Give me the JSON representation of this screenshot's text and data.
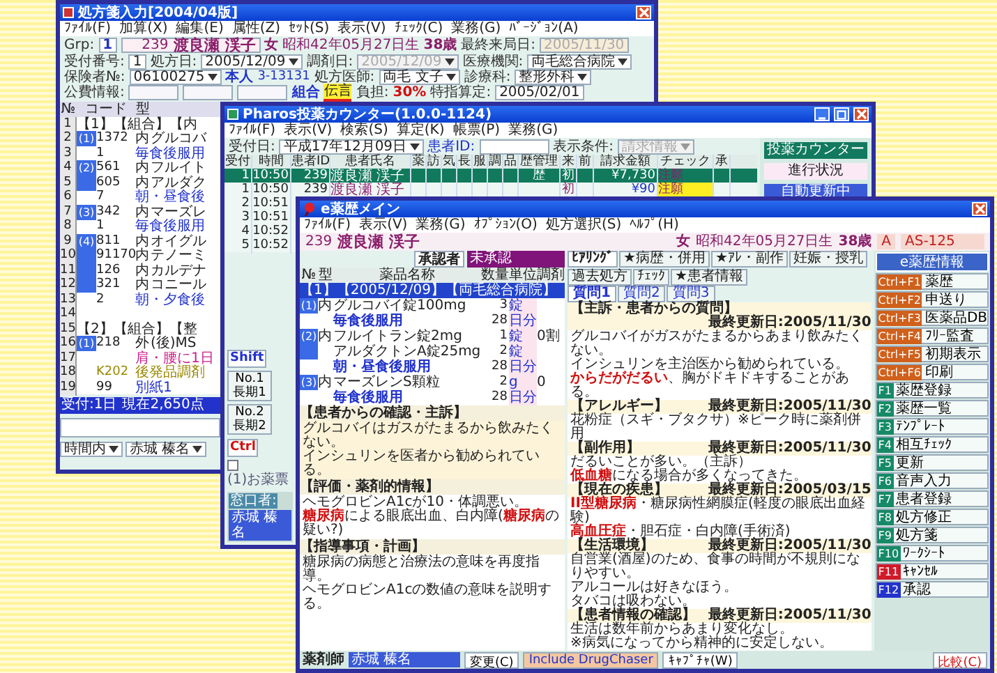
{
  "prescription_window": {
    "title": "処方箋入力[2004/04版]",
    "menu": [
      "ﾌｧｲﾙ(F)",
      "加算(X)",
      "編集(E)",
      "属性(Z)",
      "ｾｯﾄ(S)",
      "表示(V)",
      "ﾁｪｯｸ(C)",
      "業務(G)",
      "ﾊﾞｰｼﾞｮﾝ(A)"
    ],
    "patient": {
      "group_label": "Grp:",
      "group": "1",
      "id": "239",
      "name": "渡良瀬 渓子",
      "sex": "女",
      "birth": "昭和42年05月27日生",
      "age": "38歳",
      "last_visit_label": "最終来局日:",
      "last_visit": "2005/11/30"
    },
    "form_rows": [
      [
        {
          "kind": "label",
          "text": "受付番号:"
        },
        {
          "kind": "field",
          "text": "1",
          "disabled": false
        },
        {
          "kind": "label",
          "text": "処方日:"
        },
        {
          "kind": "combo",
          "text": "2005/12/09",
          "disabled": false
        },
        {
          "kind": "label",
          "text": "調剤日:"
        },
        {
          "kind": "combo",
          "text": "2005/12/09",
          "disabled": true
        },
        {
          "kind": "label",
          "text": "医療機関:"
        },
        {
          "kind": "combo",
          "text": "両毛総合病院",
          "disabled": false
        }
      ],
      [
        {
          "kind": "label",
          "text": "保険者№:"
        },
        {
          "kind": "combo",
          "text": "06100275",
          "disabled": false
        },
        {
          "kind": "accent",
          "text": "本人"
        },
        {
          "kind": "small",
          "text": "3-13131"
        },
        {
          "kind": "label",
          "text": "処方医師:"
        },
        {
          "kind": "combo",
          "text": "両毛 文子",
          "disabled": false
        },
        {
          "kind": "label",
          "text": "診療科:"
        },
        {
          "kind": "combo",
          "text": "整形外科",
          "disabled": false
        }
      ],
      [
        {
          "kind": "label",
          "text": "公費情報:"
        },
        {
          "kind": "blank"
        },
        {
          "kind": "blank"
        },
        {
          "kind": "blank"
        },
        {
          "kind": "accent",
          "text": "組合"
        },
        {
          "kind": "highlight",
          "text": "伝言"
        },
        {
          "kind": "label",
          "text": "負担:"
        },
        {
          "kind": "alert",
          "text": "30%"
        },
        {
          "kind": "label",
          "text": "特指算定:"
        },
        {
          "kind": "field",
          "text": "2005/02/01",
          "disabled": false
        }
      ]
    ],
    "columns": [
      "№",
      "コード",
      "型"
    ],
    "rows": [
      {
        "no": "1",
        "kind": "group",
        "name": "【1】【組合】【内"
      },
      {
        "no": "2",
        "kind": "drug",
        "mark": "(1)",
        "code": "1372",
        "type": "内",
        "name": "グルコバ"
      },
      {
        "no": "3",
        "kind": "usage",
        "code": "1",
        "name": "毎食後服用"
      },
      {
        "no": "4",
        "kind": "drug",
        "mark": "(2)",
        "code": "561",
        "type": "内",
        "name": "フルイト"
      },
      {
        "no": "5",
        "kind": "drug",
        "code": "605",
        "type": "内",
        "name": "アルダク"
      },
      {
        "no": "6",
        "kind": "usage",
        "code": "7",
        "name": "朝・昼食後"
      },
      {
        "no": "7",
        "kind": "drug",
        "mark": "(3)",
        "code": "342",
        "type": "内",
        "name": "マーズレ"
      },
      {
        "no": "8",
        "kind": "usage",
        "code": "1",
        "name": "毎食後服用"
      },
      {
        "no": "9",
        "kind": "drug",
        "mark": "(4)",
        "code": "811",
        "type": "内",
        "name": "オイグル"
      },
      {
        "no": "10",
        "kind": "drug",
        "code": "91170",
        "type": "内",
        "name": "テノーミ"
      },
      {
        "no": "11",
        "kind": "drug",
        "code": "126",
        "type": "内",
        "name": "カルデナ"
      },
      {
        "no": "12",
        "kind": "drug",
        "code": "321",
        "type": "内",
        "name": "コニール"
      },
      {
        "no": "13",
        "kind": "usage",
        "code": "2",
        "name": "朝・夕食後"
      },
      {
        "no": "14",
        "kind": "blank"
      },
      {
        "no": "15",
        "kind": "group",
        "name": "【2】【組合】【整"
      },
      {
        "no": "16",
        "kind": "drug",
        "mark": "(1)",
        "code": "218",
        "type": "外",
        "name": "(後)MS"
      },
      {
        "no": "17",
        "kind": "note",
        "name": "肩・腰に1日"
      },
      {
        "no": "18",
        "kind": "addon",
        "code": "K202",
        "name": "後発品調剤"
      },
      {
        "no": "19",
        "kind": "usage",
        "code": "99",
        "name": "別紙1"
      }
    ],
    "status": [
      "受付:1日",
      "現在2,650点"
    ],
    "time_slot": "時間内",
    "staff": "赤城 榛名"
  },
  "counter_window": {
    "title": "Pharos投薬カウンター(1.0.0-1124)",
    "menu": [
      "ﾌｧｲﾙ(F)",
      "表示(V)",
      "検索(S)",
      "算定(K)",
      "帳票(P)",
      "業務(G)"
    ],
    "date_label": "受付日:",
    "date": "平成17年12月09日",
    "patient_id_label": "患者ID:",
    "filter_label": "表示条件:",
    "filter": "請求情報",
    "columns": [
      "受付",
      "時間",
      "患者ID",
      "患者氏名",
      "薬",
      "訪",
      "気",
      "長",
      "服",
      "調",
      "品",
      "歴管理",
      "来",
      "前",
      "請求金額",
      "チェック",
      "承"
    ],
    "rows": [
      {
        "no": "1",
        "time": "10:50",
        "id": "239",
        "name": "渡良瀬 渓子",
        "history": "歴",
        "visit": "初",
        "amount": "¥7,730",
        "check": "注願",
        "check_alert": false,
        "selected": true
      },
      {
        "no": "1",
        "time": "10:50",
        "id": "239",
        "name": "渡良瀬 渓子",
        "visit": "初",
        "amount": "¥90",
        "check": "注願",
        "check_alert": true,
        "selected": false
      },
      {
        "no": "2",
        "time": "10:51",
        "selected": false
      },
      {
        "no": "3",
        "time": "10:51",
        "selected": false
      },
      {
        "no": "4",
        "time": "10:52",
        "selected": false
      },
      {
        "no": "5",
        "time": "10:52",
        "selected": false
      }
    ],
    "panel": [
      {
        "kind": "title",
        "text": "投薬カウンター"
      },
      {
        "kind": "status",
        "text": "進行状況"
      },
      {
        "kind": "auto",
        "text": "自動更新中"
      }
    ],
    "shift_label": "Shift",
    "shift_buttons": [
      {
        "number": "No.1",
        "label": "長期1"
      },
      {
        "number": "No.2",
        "label": "長期2"
      }
    ],
    "ctrl_label": "Ctrl",
    "options": [
      {
        "label": "(1)お薬票",
        "checked": false
      }
    ],
    "clerk_label": "窓口者:",
    "clerk": "赤城 榛名"
  },
  "record_window": {
    "title": "e薬歴メイン",
    "menu": [
      "ﾌｧｲﾙ(F)",
      "表示(V)",
      "業務(G)",
      "ｵﾌﾟｼｮﾝ(O)",
      "処方選択(S)",
      "ﾍﾙﾌﾟ(H)"
    ],
    "patient": {
      "id": "239",
      "name": "渡良瀬 渓子",
      "sex": "女",
      "birth": "昭和42年05月27日生",
      "age": "38歳",
      "grade": "A",
      "code": "AS-125"
    },
    "approver_label": "承認者",
    "approver": "未承認",
    "columns": [
      "№",
      "型",
      "薬品名称",
      "数量",
      "単位",
      "調剤"
    ],
    "rows": [
      {
        "kind": "header",
        "name": "【1】【2005/12/09】【両毛総合病院】",
        "selected": true
      },
      {
        "kind": "drug",
        "mark": "(1)",
        "type": "内",
        "name": "グルコバイ錠100mg",
        "qty": "3",
        "unit": "錠",
        "selected": false
      },
      {
        "kind": "usage",
        "name": "毎食後服用",
        "qty": "28",
        "unit": "日分",
        "selected": false
      },
      {
        "kind": "drug",
        "mark": "(2)",
        "type": "内",
        "name": "フルイトラン錠2mg",
        "qty": "1",
        "unit": "錠",
        "dispense": "0割",
        "selected": false
      },
      {
        "kind": "drug",
        "name": "アルダクトンA錠25mg",
        "qty": "2",
        "unit": "錠",
        "selected": false
      },
      {
        "kind": "usage",
        "name": "朝・昼食後服用",
        "qty": "28",
        "unit": "日分",
        "selected": false
      },
      {
        "kind": "drug",
        "mark": "(3)",
        "type": "内",
        "name": "マーズレンS顆粒",
        "qty": "2",
        "unit": "g",
        "dispense": "0",
        "selected": false
      },
      {
        "kind": "usage",
        "name": "毎食後服用",
        "qty": "28",
        "unit": "日分",
        "selected": false
      }
    ],
    "left_sections": [
      {
        "title": "【患者からの確認・主訴】",
        "lines": [
          "グルコバイはガスがたまるから飲みたくない。",
          "インシュリンを医者から勧められている。"
        ]
      },
      {
        "title": "【評価・薬剤的情報】",
        "lines": [
          "ヘモグロビンA1cが10・体調悪い。",
          "**糖尿病**による眼底出血、白内障(**糖尿病**の疑い?)"
        ]
      },
      {
        "title": "【指導事項・計画】",
        "lines": [
          "糖尿病の病態と治療法の意味を再度指導。",
          "ヘモグロビンA1cの数値の意味を説明する。"
        ]
      }
    ],
    "tabs": [
      {
        "label": "ﾋｱﾘﾝｸﾞ",
        "selected": true
      },
      {
        "label": "★病歴・併用",
        "selected": false
      },
      {
        "label": "★ｱﾚ・副作",
        "selected": false
      },
      {
        "label": "妊娠・授乳",
        "selected": false
      },
      {
        "label": "過去処方",
        "selected": false
      },
      {
        "label": "ﾁｪｯｸ",
        "selected": false
      },
      {
        "label": "★患者情報",
        "selected": false
      }
    ],
    "subtabs": [
      {
        "label": "質問1",
        "selected": true
      },
      {
        "label": "質問2",
        "selected": false
      },
      {
        "label": "質問3",
        "selected": false
      }
    ],
    "sections": [
      {
        "title": "【主訴・患者からの質問】",
        "date": "最終更新日:2005/11/30",
        "lines": [
          "グルコバイがガスがたまるからあまり飲みたくない。",
          "インシュリンを主治医から勧められている。",
          "**からだがだるい**、胸がドキドキすることがある。"
        ]
      },
      {
        "title": "【アレルギー】",
        "date": "最終更新日:2005/11/30",
        "lines": [
          "花粉症（スギ・ブタクサ）※ピーク時に薬剤併用"
        ]
      },
      {
        "title": "【副作用】",
        "date": "最終更新日:2005/11/30",
        "lines": [
          "だるいことが多い。（主訴）",
          "**低血糖**になる場合が多くなってきた。"
        ]
      },
      {
        "title": "【現在の疾患】",
        "date": "最終更新日:2005/03/15",
        "lines": [
          "**II型糖尿病**・糖尿病性網膜症(軽度の眼底出血経験)",
          "**高血圧症**・胆石症・白内障(手術済)"
        ]
      },
      {
        "title": "【生活環境】",
        "date": "最終更新日:2005/11/30",
        "lines": [
          "自営業(酒屋)のため、食事の時間が不規則になりやすい。",
          "アルコールは好きなほう。",
          "タバコは吸わない。"
        ]
      },
      {
        "title": "【患者情報の確認】",
        "date": "最終更新日:2005/11/30",
        "lines": [
          "生活は数年前からあまり変化なし。",
          "※病気になってから精神的に安定しない。"
        ]
      }
    ],
    "info_button": "e薬歴情報",
    "keys": [
      {
        "kind": "ctrl",
        "key": "Ctrl+F1",
        "label": "薬歴"
      },
      {
        "kind": "ctrl",
        "key": "Ctrl+F2",
        "label": "申送り"
      },
      {
        "kind": "ctrl",
        "key": "Ctrl+F3",
        "label": "医薬品DB"
      },
      {
        "kind": "ctrl",
        "key": "Ctrl+F4",
        "label": "ﾌﾘｰ監査"
      },
      {
        "kind": "ctrl",
        "key": "Ctrl+F5",
        "label": "初期表示"
      },
      {
        "kind": "ctrl",
        "key": "Ctrl+F6",
        "label": "印刷"
      },
      {
        "kind": "fn",
        "key": "F1",
        "label": "薬歴登録"
      },
      {
        "kind": "fn",
        "key": "F2",
        "label": "薬歴一覧"
      },
      {
        "kind": "fn",
        "key": "F3",
        "label": "ﾃﾝﾌﾟﾚｰﾄ"
      },
      {
        "kind": "fn",
        "key": "F4",
        "label": "相互ﾁｪｯｸ"
      },
      {
        "kind": "fn",
        "key": "F5",
        "label": "更新"
      },
      {
        "kind": "fn",
        "key": "F6",
        "label": "音声入力"
      },
      {
        "kind": "fn",
        "key": "F7",
        "label": "患者登録"
      },
      {
        "kind": "fn",
        "key": "F8",
        "label": "処方修正"
      },
      {
        "kind": "fn",
        "key": "F9",
        "label": "処方箋"
      },
      {
        "kind": "fn",
        "key": "F10",
        "label": "ﾜｰｸｼｰﾄ"
      },
      {
        "kind": "cancel",
        "key": "F11",
        "label": "ｷｬﾝｾﾙ"
      },
      {
        "kind": "commit",
        "key": "F12",
        "label": "承認"
      }
    ],
    "pharmacist_label": "薬剤師",
    "pharmacist": "赤城 榛名",
    "change_button": "変更(C)",
    "drugchaser_button": "Include DrugChaser",
    "capture_button": "ｷｬﾌﾟﾁｬ(W)",
    "compare_button": "比較(C)"
  }
}
